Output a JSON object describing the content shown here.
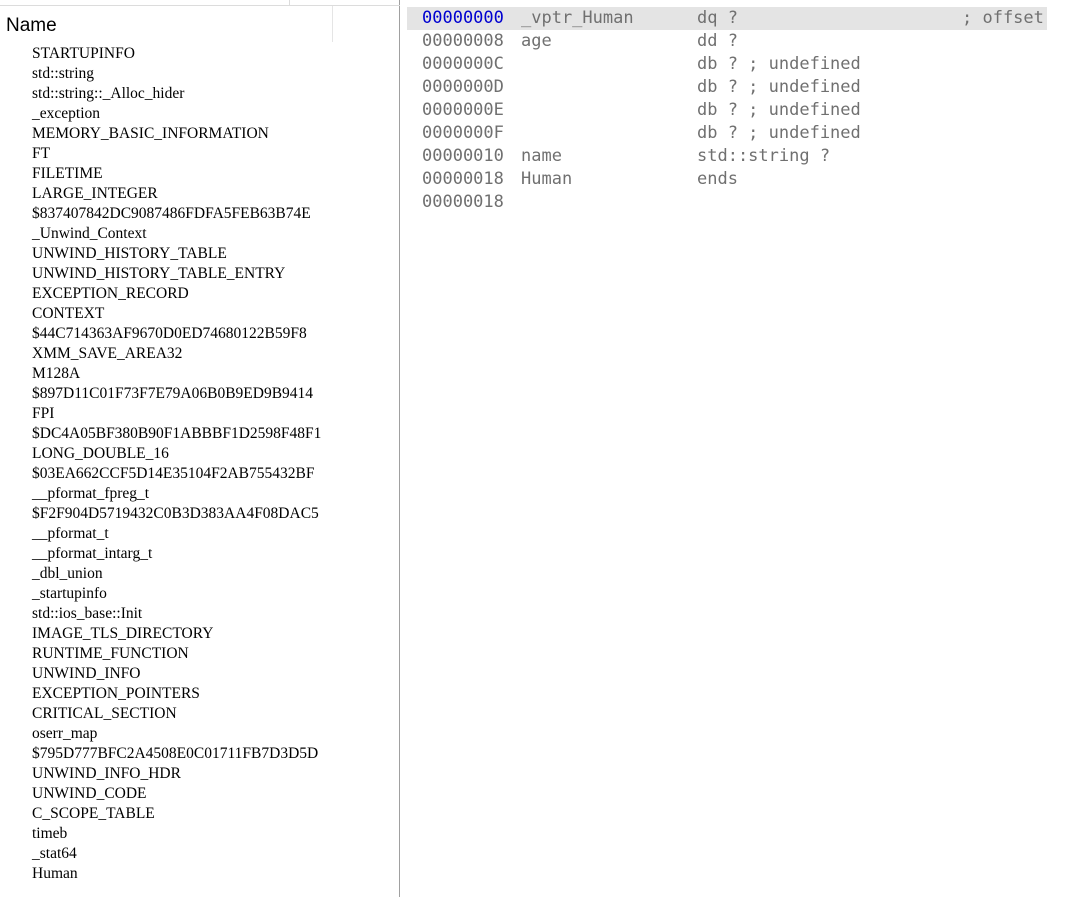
{
  "left_pane": {
    "column_header": "Name",
    "items": [
      "STARTUPINFO",
      "std::string",
      "std::string::_Alloc_hider",
      "_exception",
      "MEMORY_BASIC_INFORMATION",
      "FT",
      "FILETIME",
      "LARGE_INTEGER",
      "$837407842DC9087486FDFA5FEB63B74E",
      "_Unwind_Context",
      "UNWIND_HISTORY_TABLE",
      "UNWIND_HISTORY_TABLE_ENTRY",
      "EXCEPTION_RECORD",
      "CONTEXT",
      "$44C714363AF9670D0ED74680122B59F8",
      "XMM_SAVE_AREA32",
      "M128A",
      "$897D11C01F73F7E79A06B0B9ED9B9414",
      "FPI",
      "$DC4A05BF380B90F1ABBBF1D2598F48F1",
      "LONG_DOUBLE_16",
      "$03EA662CCF5D14E35104F2AB755432BF",
      "__pformat_fpreg_t",
      "$F2F904D5719432C0B3D383AA4F08DAC5",
      "__pformat_t",
      "__pformat_intarg_t",
      "_dbl_union",
      "_startupinfo",
      "std::ios_base::Init",
      "IMAGE_TLS_DIRECTORY",
      "RUNTIME_FUNCTION",
      "UNWIND_INFO",
      "EXCEPTION_POINTERS",
      "CRITICAL_SECTION",
      "oserr_map",
      "$795D777BFC2A4508E0C01711FB7D3D5D",
      "UNWIND_INFO_HDR",
      "UNWIND_CODE",
      "C_SCOPE_TABLE",
      "timeb",
      "_stat64",
      "Human"
    ]
  },
  "struct_view": {
    "lines": [
      {
        "addr": "00000000",
        "name": "_vptr_Human",
        "type": "dq ?",
        "comment": "; offset",
        "active": true
      },
      {
        "addr": "00000008",
        "name": "age",
        "type": "dd ?",
        "comment": ""
      },
      {
        "addr": "0000000C",
        "name": "",
        "type": "db ? ; undefined",
        "comment": ""
      },
      {
        "addr": "0000000D",
        "name": "",
        "type": "db ? ; undefined",
        "comment": ""
      },
      {
        "addr": "0000000E",
        "name": "",
        "type": "db ? ; undefined",
        "comment": ""
      },
      {
        "addr": "0000000F",
        "name": "",
        "type": "db ? ; undefined",
        "comment": ""
      },
      {
        "addr": "00000010",
        "name": "name",
        "type": "std::string ?",
        "comment": ""
      },
      {
        "addr": "00000018",
        "name": "Human",
        "type": "ends",
        "comment": ""
      },
      {
        "addr": "00000018",
        "name": "",
        "type": "",
        "comment": ""
      }
    ]
  },
  "colors": {
    "active_address": "#0000d0",
    "code_text": "#707070",
    "highlight_row": "#e4e4e4"
  }
}
